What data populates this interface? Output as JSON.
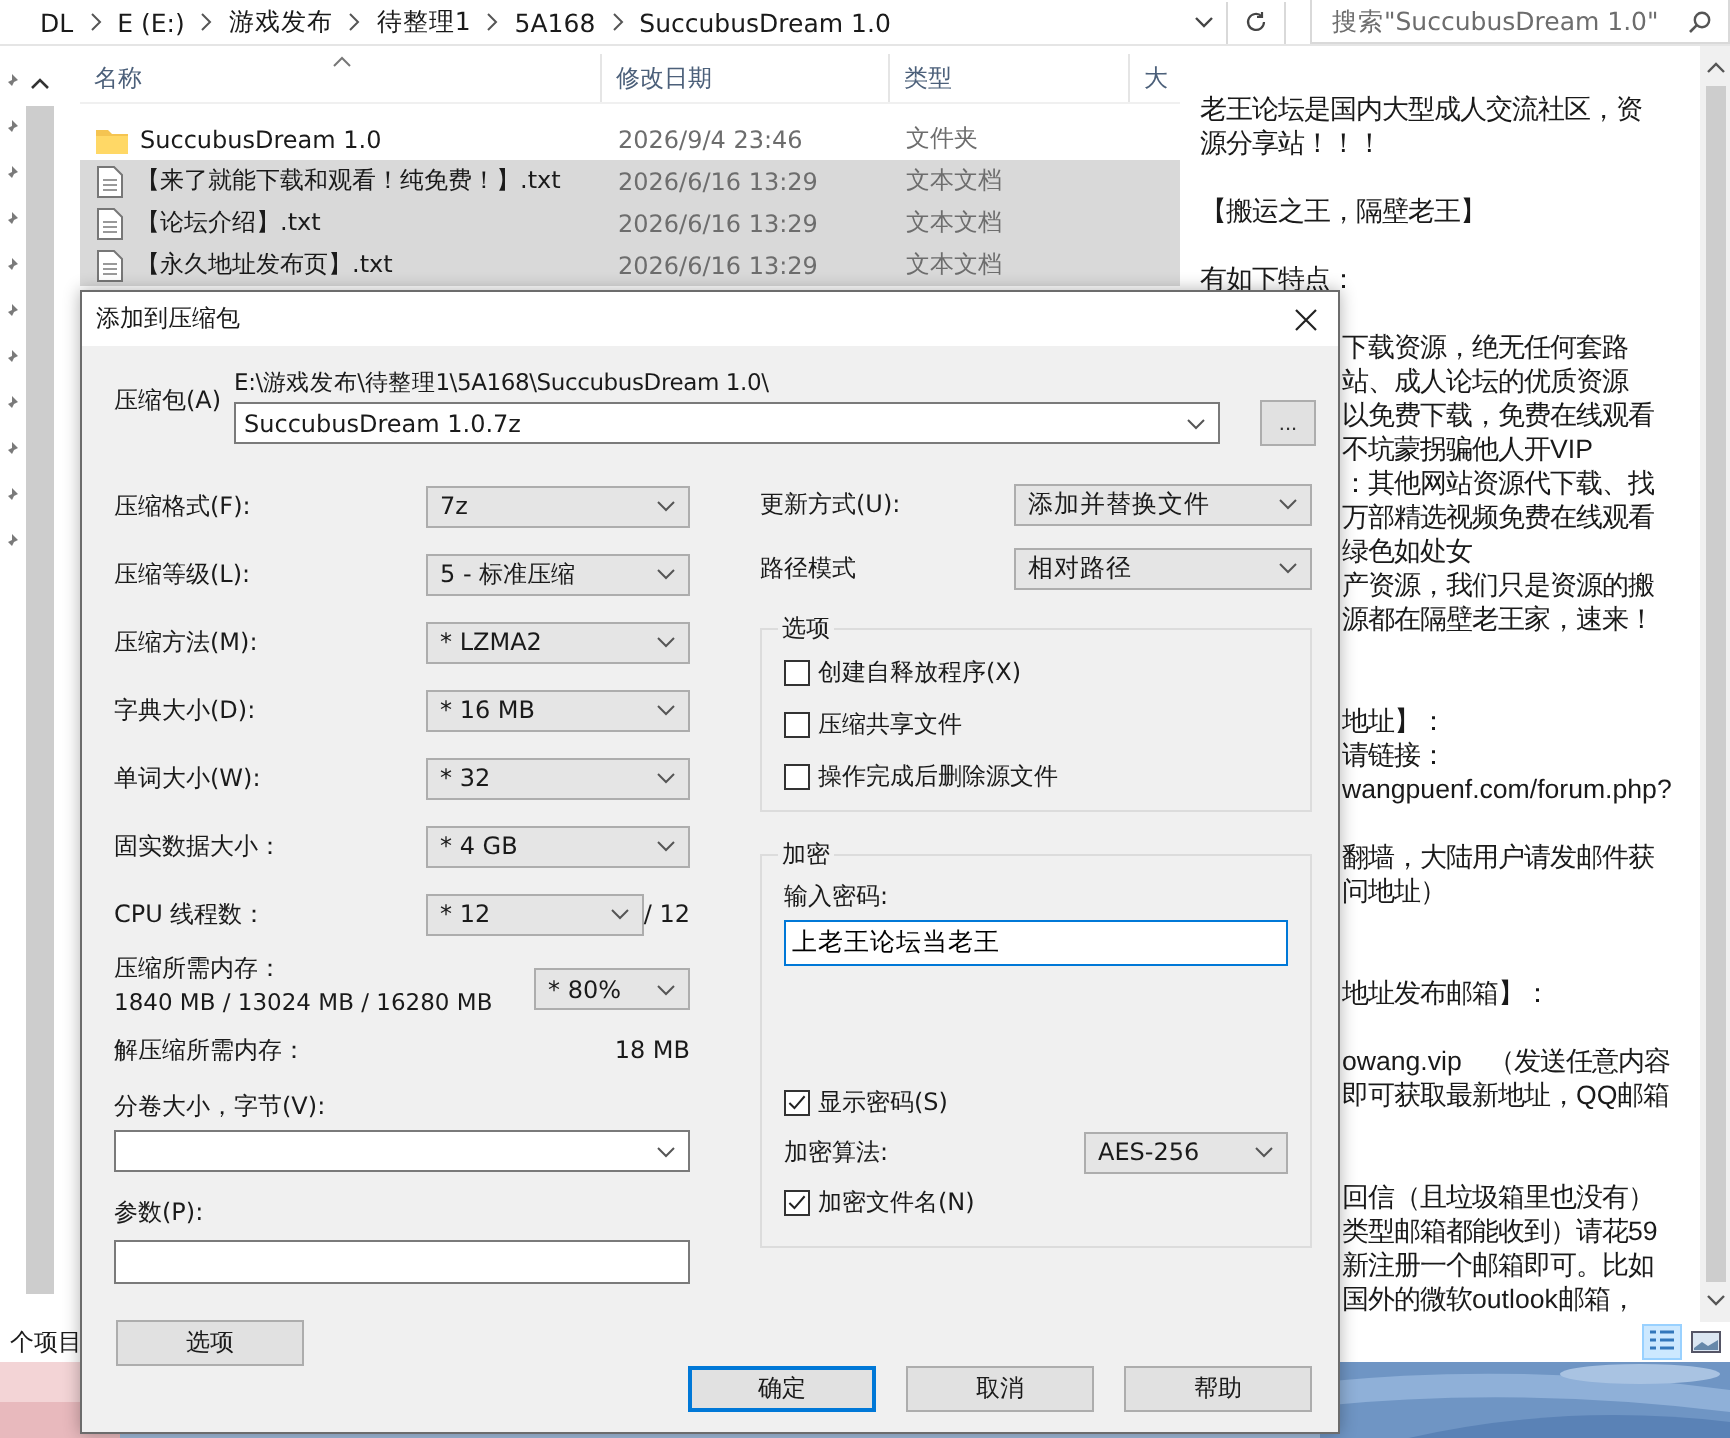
{
  "explorer": {
    "breadcrumbs": [
      "DL",
      "E (E:)",
      "游戏发布",
      "待整理1",
      "5A168",
      "SuccubusDream 1.0"
    ],
    "search": {
      "placeholder": "搜索\"SuccubusDream 1.0\""
    },
    "columns": [
      "名称",
      "修改日期",
      "类型",
      "大"
    ],
    "files": [
      {
        "name": "SuccubusDream 1.0",
        "date": "2026/9/4 23:46",
        "type": "文件夹",
        "kind": "folder",
        "selected": false
      },
      {
        "name": "【来了就能下载和观看！纯免费！】.txt",
        "date": "2026/6/16 13:29",
        "type": "文本文档",
        "kind": "text",
        "selected": true
      },
      {
        "name": "【论坛介绍】.txt",
        "date": "2026/6/16 13:29",
        "type": "文本文档",
        "kind": "text",
        "selected": true
      },
      {
        "name": "【永久地址发布页】.txt",
        "date": "2026/6/16 13:29",
        "type": "文本文档",
        "kind": "text",
        "selected": true
      }
    ],
    "status": "个项目",
    "preview_lines": [
      {
        "kind": "full",
        "text": "老王论坛是国内大型成人交流社区，资"
      },
      {
        "kind": "full",
        "text": "源分享站！！！"
      },
      {
        "kind": "blank"
      },
      {
        "kind": "full",
        "text": "【搬运之王，隔壁老王】"
      },
      {
        "kind": "blank"
      },
      {
        "kind": "full",
        "text": "有如下特点："
      },
      {
        "kind": "blank"
      },
      {
        "kind": "cut",
        "text": "下载资源，绝无任何套路"
      },
      {
        "kind": "cut",
        "text": "站、成人论坛的优质资源"
      },
      {
        "kind": "cut",
        "text": "以免费下载，免费在线观看"
      },
      {
        "kind": "cut",
        "text": "不坑蒙拐骗他人开VIP"
      },
      {
        "kind": "cut",
        "text": "：其他网站资源代下载、找"
      },
      {
        "kind": "cut",
        "text": "万部精选视频免费在线观看"
      },
      {
        "kind": "cut",
        "text": "绿色如处女"
      },
      {
        "kind": "cut",
        "text": "产资源，我们只是资源的搬"
      },
      {
        "kind": "cut",
        "text": "源都在隔壁老王家，速来！"
      },
      {
        "kind": "blank"
      },
      {
        "kind": "blank"
      },
      {
        "kind": "cut",
        "text": "地址】："
      },
      {
        "kind": "cut",
        "text": "请链接："
      },
      {
        "kind": "cut",
        "text": "wangpuenf.com/forum.php?"
      },
      {
        "kind": "blank"
      },
      {
        "kind": "cut",
        "text": "翻墙，大陆用户请发邮件获"
      },
      {
        "kind": "cut",
        "text": "问地址）"
      },
      {
        "kind": "blank"
      },
      {
        "kind": "blank"
      },
      {
        "kind": "cut",
        "text": "地址发布邮箱】："
      },
      {
        "kind": "blank"
      },
      {
        "kind": "cut",
        "text": "owang.vip　（发送任意内容"
      },
      {
        "kind": "cut",
        "text": "即可获取最新地址，QQ邮箱"
      },
      {
        "kind": "blank"
      },
      {
        "kind": "blank"
      },
      {
        "kind": "cut",
        "text": "回信（且垃圾箱里也没有）"
      },
      {
        "kind": "cut",
        "text": "类型邮箱都能收到）请花59"
      },
      {
        "kind": "cut",
        "text": "新注册一个邮箱即可。比如"
      },
      {
        "kind": "cut",
        "text": "国外的微软outlook邮箱，"
      }
    ]
  },
  "dialog": {
    "title": "添加到压缩包",
    "archive": {
      "label": "压缩包(A)",
      "path": "E:\\游戏发布\\待整理1\\5A168\\SuccubusDream 1.0\\",
      "value": "SuccubusDream 1.0.7z",
      "browse": "..."
    },
    "settings": [
      {
        "label": "压缩格式(F):",
        "value": "7z"
      },
      {
        "label": "压缩等级(L):",
        "value": "5 - 标准压缩"
      },
      {
        "label": "压缩方法(M):",
        "value": "* LZMA2"
      },
      {
        "label": "字典大小(D):",
        "value": "* 16 MB"
      },
      {
        "label": "单词大小(W):",
        "value": "* 32"
      },
      {
        "label": "固实数据大小：",
        "value": "* 4 GB"
      }
    ],
    "threads": {
      "label": "CPU 线程数：",
      "value": "* 12",
      "max": "/ 12"
    },
    "memory": {
      "label": "压缩所需内存：",
      "detail": "1840 MB / 13024 MB / 16280 MB",
      "value": "* 80%"
    },
    "decompress_memory": {
      "label": "解压缩所需内存：",
      "value": "18 MB"
    },
    "volume": {
      "label": "分卷大小，字节(V):"
    },
    "params": {
      "label": "参数(P):"
    },
    "options_button": "选项",
    "update": {
      "label": "更新方式(U):",
      "value": "添加并替换文件"
    },
    "path_mode": {
      "label": "路径模式",
      "value": "相对路径"
    },
    "options_group": {
      "title": "选项",
      "items": [
        {
          "label": "创建自释放程序(X)",
          "checked": false
        },
        {
          "label": "压缩共享文件",
          "checked": false
        },
        {
          "label": "操作完成后删除源文件",
          "checked": false
        }
      ]
    },
    "encryption": {
      "title": "加密",
      "password_label": "输入密码:",
      "password": "上老王论坛当老王",
      "show_password": {
        "label": "显示密码(S)",
        "checked": true
      },
      "method": {
        "label": "加密算法:",
        "value": "AES-256"
      },
      "encrypt_names": {
        "label": "加密文件名(N)",
        "checked": true
      }
    },
    "buttons": [
      {
        "label": "确定",
        "default": true
      },
      {
        "label": "取消",
        "default": false
      },
      {
        "label": "帮助",
        "default": false
      }
    ]
  }
}
